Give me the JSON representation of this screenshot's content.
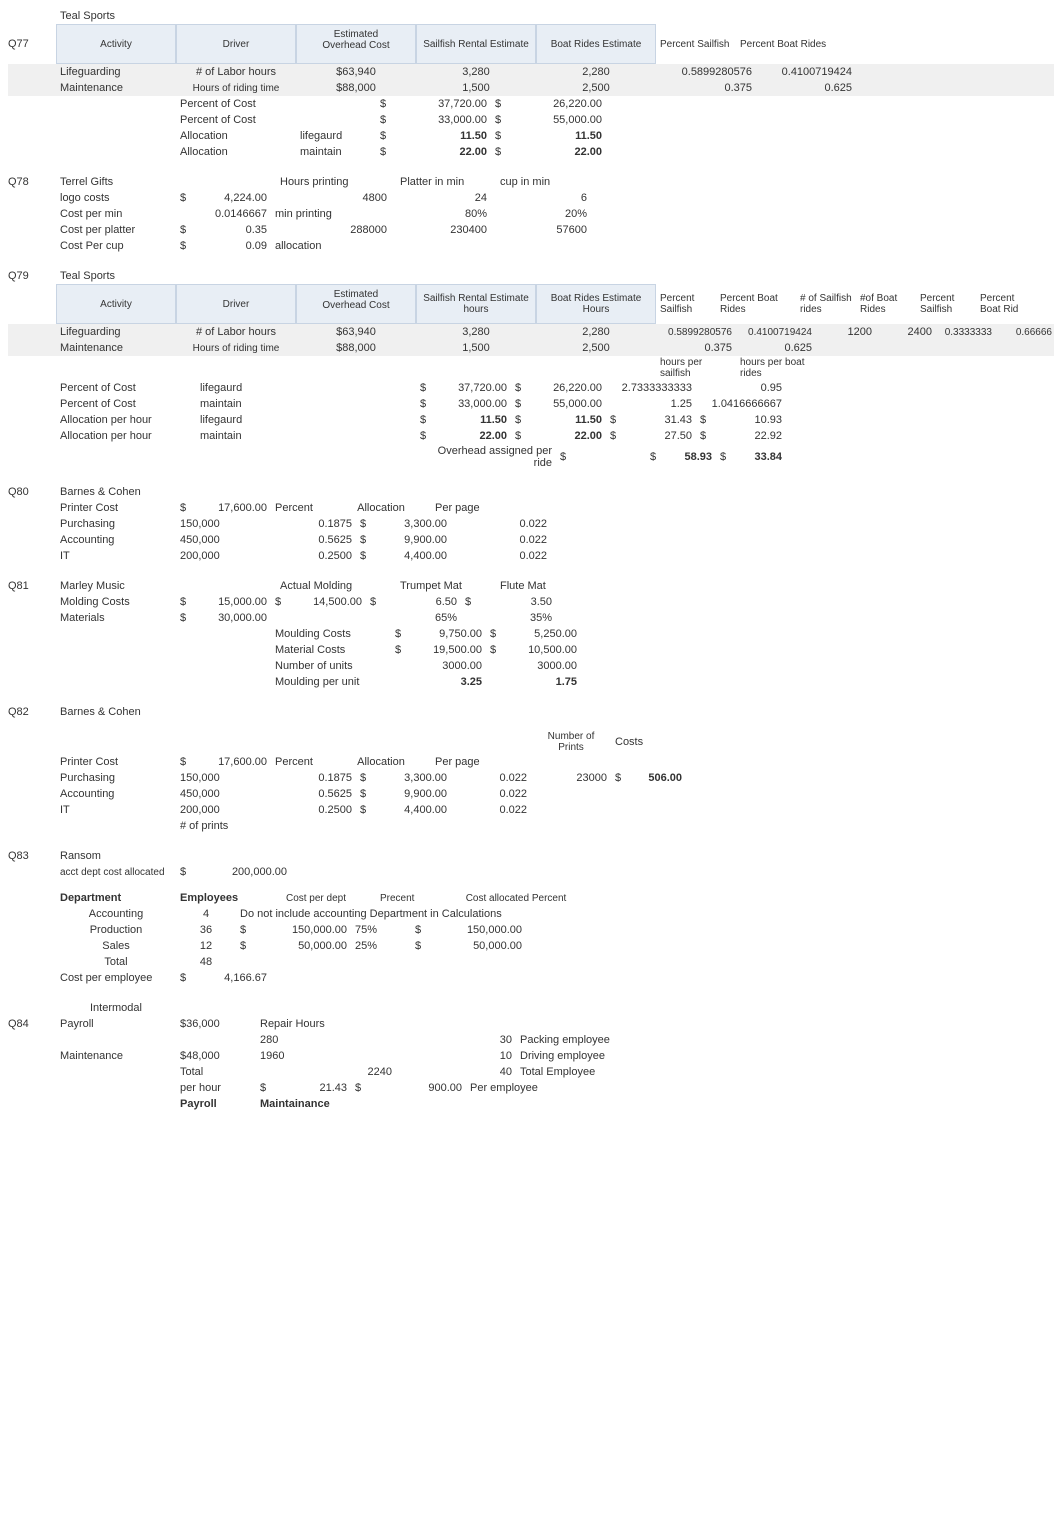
{
  "q77": {
    "qnum": "Q77",
    "title": "Teal Sports",
    "headers": [
      "Activity",
      "Driver",
      "Estimated",
      "Overhead Cost",
      "Sailfish Rental Estimate",
      "Boat Rides Estimate",
      "Percent Sailfish",
      "Percent Boat Rides"
    ],
    "h_activity": "Activity",
    "h_driver": "Driver",
    "h_est": "Estimated",
    "h_ovh": "Overhead Cost",
    "h_sre": "Sailfish Rental Estimate",
    "h_bre": "Boat Rides Estimate",
    "h_ps": "Percent Sailfish",
    "h_pbr": "Percent Boat Rides",
    "r1": {
      "act": "Lifeguarding",
      "drv": "# of Labor hours",
      "ovh": "$63,940",
      "sre": "3,280",
      "bre": "2,280"
    },
    "r2": {
      "act": "Maintenance",
      "drv": "Hours of riding time",
      "ovh": "$88,000",
      "sre": "1,500",
      "bre": "2,500"
    },
    "p1": {
      "a": "0.5899280576",
      "b": "0.4100719424"
    },
    "p2": {
      "a": "0.375",
      "b": "0.625"
    },
    "rows": [
      {
        "lbl": "Percent of Cost",
        "sub": "",
        "d": "$",
        "v1": "37,720.00",
        "d2": "$",
        "v2": "26,220.00"
      },
      {
        "lbl": "Percent of Cost",
        "sub": "",
        "d": "$",
        "v1": "33,000.00",
        "d2": "$",
        "v2": "55,000.00"
      },
      {
        "lbl": "Allocation",
        "sub": "lifegaurd",
        "d": "$",
        "v1": "11.50",
        "d2": "$",
        "v2": "11.50"
      },
      {
        "lbl": "Allocation",
        "sub": "maintain",
        "d": "$",
        "v1": "22.00",
        "d2": "$",
        "v2": "22.00"
      }
    ]
  },
  "q78": {
    "qnum": "Q78",
    "title": "Terrel Gifts",
    "h1": "Hours printing",
    "h2": "Platter in min",
    "h3": "cup in min",
    "r1": {
      "lbl": "logo costs",
      "a": "$",
      "b": "4,224.00",
      "c": "4800",
      "d": "24",
      "e": "6"
    },
    "r2": {
      "lbl": "Cost per min",
      "b": "0.0146667",
      "b2": "min printing",
      "d": "80%",
      "e": "20%"
    },
    "r3": {
      "lbl": "Cost per platter",
      "a": "$",
      "b": "0.35",
      "c": "288000",
      "d": "230400",
      "e": "57600"
    },
    "r4": {
      "lbl": "Cost Per cup",
      "a": "$",
      "b": "0.09",
      "b2": "allocation"
    }
  },
  "q79": {
    "qnum": "Q79",
    "title": "Teal Sports",
    "h_activity": "Activity",
    "h_driver": "Driver",
    "h_est": "Estimated",
    "h_ovh": "Overhead Cost",
    "h_sre": "Sailfish Rental Estimate hours",
    "h_bre": "Boat Rides Estimate Hours",
    "h_ps": "Percent Sailfish",
    "h_pbr": "Percent Boat Rides",
    "h_nsr": "# of Sailfish rides",
    "h_nbr": "#of Boat Rides",
    "h_psf": "Percent Sailfish",
    "h_pbrd": "Percent Boat Rid",
    "r1": {
      "act": "Lifeguarding",
      "drv": "# of Labor hours",
      "ovh": "$63,940",
      "sre": "3,280",
      "bre": "2,280"
    },
    "r2": {
      "act": "Maintenance",
      "drv": "Hours of riding time",
      "ovh": "$88,000",
      "sre": "1,500",
      "bre": "2,500"
    },
    "p1": {
      "a": "0.5899280576",
      "b": "0.4100719424",
      "c": "1200",
      "d": "2400",
      "e": "0.3333333",
      "f": "0.66666"
    },
    "p2": {
      "a": "0.375",
      "b": "0.625"
    },
    "sub1": "hours per sailfish",
    "sub2": "hours per boat rides",
    "rows": [
      {
        "lbl": "Percent of Cost",
        "sub": "lifegaurd",
        "d": "$",
        "v1": "37,720.00",
        "d2": "$",
        "v2": "26,220.00",
        "v3": "2.7333333333",
        "v4": "0.95"
      },
      {
        "lbl": "Percent of Cost",
        "sub": "maintain",
        "d": "$",
        "v1": "33,000.00",
        "d2": "$",
        "v2": "55,000.00",
        "v3": "1.25",
        "v4": "1.0416666667"
      },
      {
        "lbl": "Allocation per hour",
        "sub": "lifegaurd",
        "d": "$",
        "v1": "11.50",
        "d2": "$",
        "v2": "11.50",
        "v3d": "$",
        "v3": "31.43",
        "v4d": "$",
        "v4": "10.93"
      },
      {
        "lbl": "Allocation per hour",
        "sub": "maintain",
        "d": "$",
        "v1": "22.00",
        "d2": "$",
        "v2": "22.00",
        "v3d": "$",
        "v3": "27.50",
        "v4d": "$",
        "v4": "22.92"
      }
    ],
    "ovh_lbl": "Overhead assigned per ride",
    "ovh_d": "$",
    "ovh_a": "58.93",
    "ovh_b": "$",
    "ovh_c": "33.84"
  },
  "q80": {
    "qnum": "Q80",
    "title": "Barnes & Cohen",
    "r0": {
      "lbl": "Printer Cost",
      "a": "$",
      "b": "17,600.00",
      "c": "Percent",
      "d": "Allocation",
      "e": "Per page"
    },
    "rows": [
      {
        "lbl": "Purchasing",
        "a": "150,000",
        "c": "0.1875",
        "cd": "$",
        "d": "3,300.00",
        "e": "0.022"
      },
      {
        "lbl": "Accounting",
        "a": "450,000",
        "c": "0.5625",
        "cd": "$",
        "d": "9,900.00",
        "e": "0.022"
      },
      {
        "lbl": "IT",
        "a": "200,000",
        "c": "0.2500",
        "cd": "$",
        "d": "4,400.00",
        "e": "0.022"
      }
    ]
  },
  "q81": {
    "qnum": "Q81",
    "title": "Marley Music",
    "h1": "Actual Molding",
    "h2": "Trumpet Mat",
    "h3": "Flute Mat",
    "r1": {
      "lbl": "Molding Costs",
      "a": "$",
      "b": "15,000.00",
      "c": "$",
      "d": "14,500.00",
      "e": "$",
      "f": "6.50",
      "g": "$",
      "h": "3.50"
    },
    "r2": {
      "lbl": "Materials",
      "a": "$",
      "b": "30,000.00",
      "f": "65%",
      "h": "35%"
    },
    "rows": [
      {
        "lbl": "Moulding Costs",
        "d": "$",
        "v1": "9,750.00",
        "d2": "$",
        "v2": "5,250.00"
      },
      {
        "lbl": "Material Costs",
        "d": "$",
        "v1": "19,500.00",
        "d2": "$",
        "v2": "10,500.00"
      },
      {
        "lbl": "Number of units",
        "v1": "3000.00",
        "v2": "3000.00"
      },
      {
        "lbl": "Moulding per unit",
        "v1": "3.25",
        "v2": "1.75"
      }
    ]
  },
  "q82": {
    "qnum": "Q82",
    "title": "Barnes & Cohen",
    "h_np": "Number of Prints",
    "h_c": "Costs",
    "r0": {
      "lbl": "Printer Cost",
      "a": "$",
      "b": "17,600.00",
      "c": "Percent",
      "d": "Allocation",
      "e": "Per page"
    },
    "rows": [
      {
        "lbl": "Purchasing",
        "a": "150,000",
        "c": "0.1875",
        "cd": "$",
        "d": "3,300.00",
        "e": "0.022",
        "np": "23000",
        "cd2": "$",
        "cost": "506.00"
      },
      {
        "lbl": "Accounting",
        "a": "450,000",
        "c": "0.5625",
        "cd": "$",
        "d": "9,900.00",
        "e": "0.022"
      },
      {
        "lbl": "IT",
        "a": "200,000",
        "c": "0.2500",
        "cd": "$",
        "d": "4,400.00",
        "e": "0.022"
      }
    ],
    "ftr": "# of prints"
  },
  "q83": {
    "qnum": "Q83",
    "title": "Ransom",
    "sub": "acct dept cost allocated",
    "a": "$",
    "b": "200,000.00",
    "h_dept": "Department",
    "h_emp": "Employees",
    "h_cpd": "Cost per dept",
    "h_pre": "Precent",
    "h_cap": "Cost allocated Percent",
    "rows": [
      {
        "dept": "Accounting",
        "emp": "4",
        "note": "Do not include accounting Department in Calculations"
      },
      {
        "dept": "Production",
        "emp": "36",
        "d": "$",
        "cpd": "150,000.00",
        "pre": "75%",
        "d2": "$",
        "cap": "150,000.00"
      },
      {
        "dept": "Sales",
        "emp": "12",
        "d": "$",
        "cpd": "50,000.00",
        "pre": "25%",
        "d2": "$",
        "cap": "50,000.00"
      },
      {
        "dept": "Total",
        "emp": "48"
      }
    ],
    "cpe_lbl": "Cost per employee",
    "cpe_d": "$",
    "cpe": "4,166.67"
  },
  "q84": {
    "qnum": "Q84",
    "title": "Intermodal",
    "r1": {
      "lbl": "Payroll",
      "a": "$36,000",
      "b": "Repair Hours"
    },
    "r1b": {
      "b": "280",
      "c": "30",
      "d": "Packing employee"
    },
    "r2": {
      "lbl": "Maintenance",
      "a": "$48,000",
      "b": "1960",
      "c": "10",
      "d": "Driving employee"
    },
    "r3": {
      "lbl": "Total",
      "b": "2240",
      "c": "40",
      "d": "Total Employee"
    },
    "r4": {
      "lbl": "per hour",
      "a": "$",
      "b": "21.43",
      "c": "$",
      "d": "900.00",
      "e": "Per employee"
    },
    "r5": {
      "a": "Payroll",
      "b": "Maintainance"
    }
  }
}
